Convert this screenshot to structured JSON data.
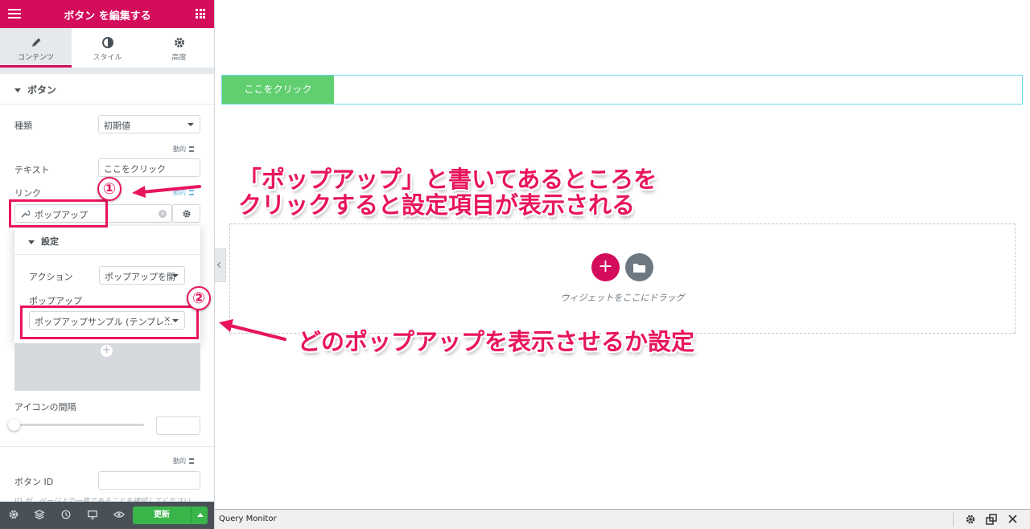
{
  "topbar": {
    "title": "ボタン を編集する"
  },
  "tabs": [
    {
      "label": "コンテンツ",
      "icon": "pencil-icon"
    },
    {
      "label": "スタイル",
      "icon": "half-circle-icon"
    },
    {
      "label": "高度",
      "icon": "gear-icon"
    }
  ],
  "section": {
    "title": "ボタン"
  },
  "fields": {
    "type_label": "種類",
    "type_value": "初期値",
    "dynamic_label": "動的",
    "text_label": "テキスト",
    "text_value": "ここをクリック",
    "link_label": "リンク",
    "link_value": "ポップアップ",
    "icon_spacing_label": "アイコンの間隔",
    "button_id_label": "ボタン ID",
    "help_text": "ID が、ページ上で一意であることを確認してください。"
  },
  "popover": {
    "title": "設定",
    "action_label": "アクション",
    "action_value": "ポップアップを開",
    "popup_label": "ポップアップ",
    "popup_value": "ポップアップサンプル (テンプレ..."
  },
  "footer": {
    "update_label": "更新"
  },
  "canvas": {
    "button_text": "ここをクリック",
    "dropzone_text": "ウィジェットをここにドラッグ"
  },
  "query_monitor": {
    "title": "Query Monitor"
  },
  "annotations": {
    "step1": "①",
    "step2": "②",
    "text1_line1": "「ポップアップ」と書いてあるところを",
    "text1_line2": "クリックすると設定項目が表示される",
    "text2": "どのポップアップを表示させるか設定"
  },
  "colors": {
    "brand": "#d30c5c",
    "annotation": "#e8155e",
    "canvas_button": "#61ce70",
    "update_button": "#39b54a"
  }
}
